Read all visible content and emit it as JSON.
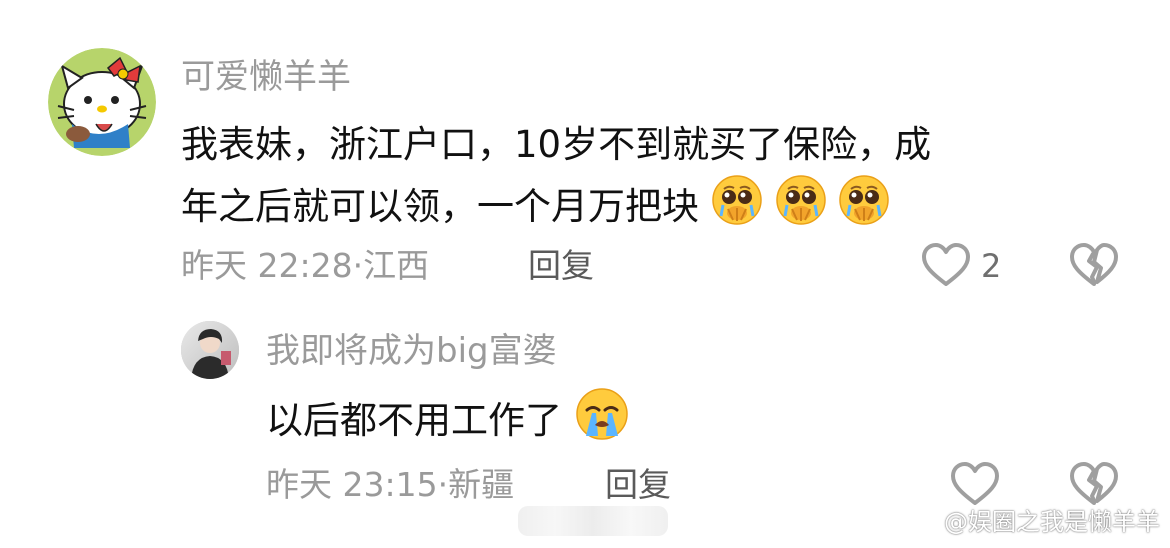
{
  "comments": [
    {
      "username": "可爱懒羊羊",
      "content_line1": "我表妹，浙江户口，10岁不到就买了保险，成",
      "content_line2": "年之后就可以领，一个月万把块",
      "time": "昨天 22:28",
      "location": "江西",
      "meta_separator": "·",
      "reply_label": "回复",
      "like_count": "2",
      "emojis": [
        "pleading-face-emoji",
        "pleading-face-emoji",
        "pleading-face-emoji"
      ]
    },
    {
      "username": "我即将成为big富婆",
      "content": "以后都不用工作了",
      "time": "昨天 23:15",
      "location": "新疆",
      "meta_separator": "·",
      "reply_label": "回复",
      "emojis": [
        "crying-face-emoji"
      ]
    }
  ],
  "watermark": {
    "text": "@娱圈之我是懒羊羊"
  },
  "colors": {
    "text": "#111111",
    "meta": "#9a9a9a",
    "reply": "#5a5a5a",
    "icon": "#9f9f9f"
  }
}
